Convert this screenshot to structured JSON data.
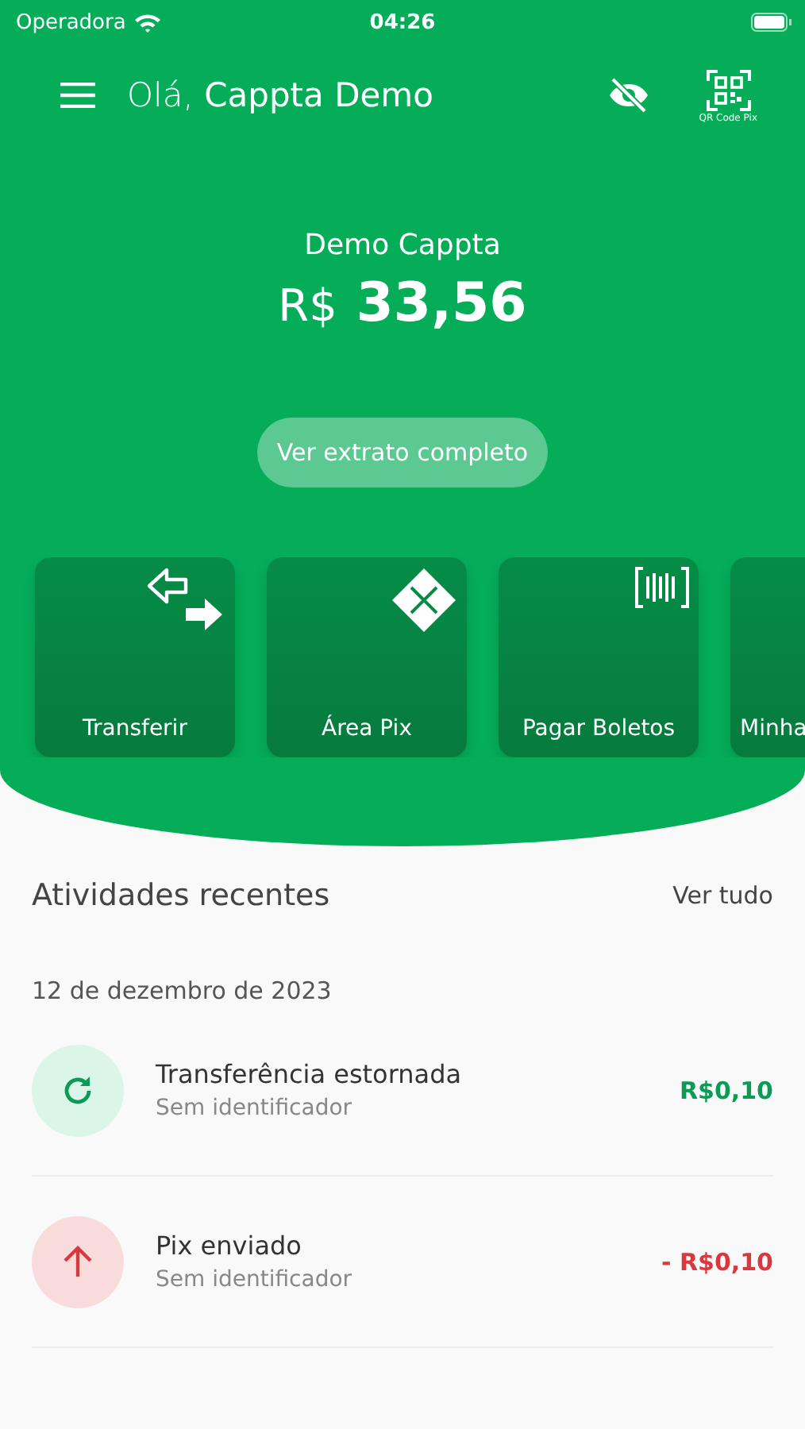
{
  "status_bar": {
    "carrier": "Operadora",
    "time": "04:26"
  },
  "header": {
    "greeting": "Olá,",
    "user": "Cappta Demo",
    "qr_label": "QR Code Pix"
  },
  "account": {
    "name": "Demo Cappta",
    "currency": "R$",
    "balance": "33,56",
    "statement_button": "Ver extrato completo"
  },
  "shortcuts": [
    {
      "kind": "transfer",
      "label": "Transferir"
    },
    {
      "kind": "pix",
      "label": "Área Pix"
    },
    {
      "kind": "boleto",
      "label": "Pagar Boletos"
    },
    {
      "kind": "other",
      "label": "Minha"
    }
  ],
  "recent": {
    "title": "Atividades recentes",
    "see_all": "Ver tudo",
    "date": "12 de dezembro de 2023",
    "items": [
      {
        "kind": "refund",
        "title": "Transferência estornada",
        "subtitle": "Sem identificador",
        "amount": "R$0,10"
      },
      {
        "kind": "sent",
        "title": "Pix enviado",
        "subtitle": "Sem identificador",
        "amount": "- R$0,10"
      }
    ]
  }
}
